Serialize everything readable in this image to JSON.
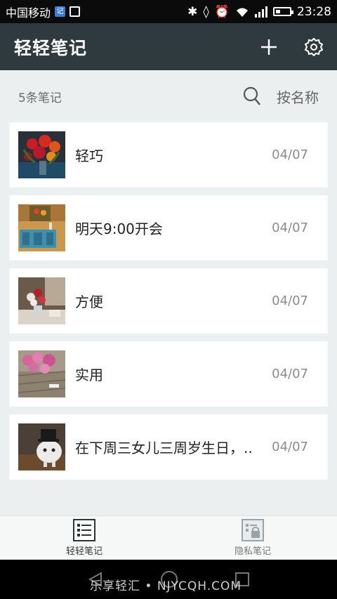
{
  "status_bar": {
    "carrier": "中国移动",
    "badge": "记",
    "time": "23:28"
  },
  "app_bar": {
    "title": "轻轻笔记",
    "icons": [
      "plus-icon",
      "gear-icon"
    ]
  },
  "toolbar": {
    "note_count": "5条笔记",
    "sort_label": "按名称"
  },
  "notes": [
    {
      "title": "轻巧",
      "date": "04/07",
      "thumb": "red-flowers-bouquet"
    },
    {
      "title": "明天9:00开会",
      "date": "04/07",
      "thumb": "blue-cabinet-room"
    },
    {
      "title": "方便",
      "date": "04/07",
      "thumb": "flowers-on-table"
    },
    {
      "title": "实用",
      "date": "04/07",
      "thumb": "pink-flowers-wood"
    },
    {
      "title": "在下周三女儿三周岁生日，..",
      "date": "04/07",
      "thumb": "white-toy-figure"
    }
  ],
  "bottom_nav": {
    "tabs": [
      {
        "label": "轻轻笔记",
        "icon": "notes-list-icon",
        "active": true
      },
      {
        "label": "隐私笔记",
        "icon": "private-notes-icon",
        "active": false
      }
    ]
  },
  "watermark": "乐享轻汇 • NJYCQH.COM",
  "colors": {
    "app_bar": "#2e3a3d",
    "background": "#eceff0",
    "card": "#ffffff"
  }
}
